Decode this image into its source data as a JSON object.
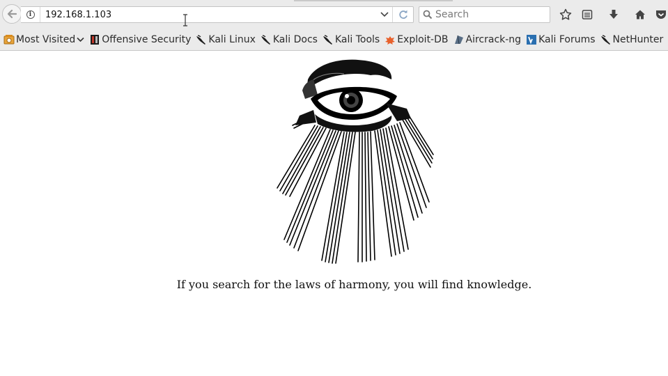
{
  "browser": {
    "url": "192.168.1.103",
    "search_placeholder": "Search"
  },
  "bookmarks": [
    {
      "label": "Most Visited",
      "icon": "most-visited-icon",
      "has_dropdown": true
    },
    {
      "label": "Offensive Security",
      "icon": "offensive-security-icon"
    },
    {
      "label": "Kali Linux",
      "icon": "kali-dragon-icon"
    },
    {
      "label": "Kali Docs",
      "icon": "kali-dragon-icon"
    },
    {
      "label": "Kali Tools",
      "icon": "kali-dragon-icon"
    },
    {
      "label": "Exploit-DB",
      "icon": "exploit-db-icon"
    },
    {
      "label": "Aircrack-ng",
      "icon": "aircrack-icon"
    },
    {
      "label": "Kali Forums",
      "icon": "kali-forums-icon"
    },
    {
      "label": "NetHunter",
      "icon": "kali-dragon-icon"
    }
  ],
  "page": {
    "quote": "If you search for the laws of harmony, you will find knowledge."
  },
  "colors": {
    "toolbar_bg": "#ebebeb",
    "page_bg": "#ffffff",
    "reload_icon": "#8aa5c4"
  }
}
